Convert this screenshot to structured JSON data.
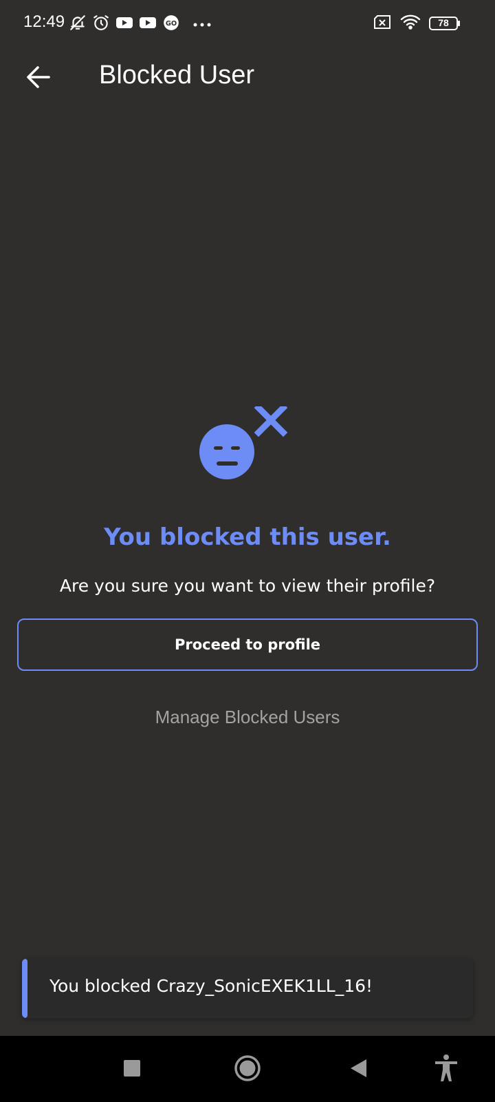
{
  "status_bar": {
    "time": "12:49",
    "battery": "78",
    "icons": [
      "bell-off-icon",
      "alarm-icon",
      "youtube-icon",
      "youtube-icon",
      "go-icon",
      "more-dots-icon",
      "sim-x-icon",
      "wifi-icon",
      "battery-icon"
    ]
  },
  "app_bar": {
    "title": "Blocked User",
    "back_icon": "arrow-left-icon"
  },
  "main": {
    "illustration_icon": "blocked-face-icon",
    "heading": "You blocked this user.",
    "confirm_text": "Are you sure you want to view their profile?",
    "proceed_label": "Proceed to profile",
    "manage_label": "Manage Blocked Users"
  },
  "toast": {
    "message": "You blocked Crazy_SonicEXEK1LL_16!"
  },
  "nav_bar": {
    "icons": [
      "recents-square-icon",
      "home-circle-icon",
      "back-triangle-icon",
      "accessibility-icon"
    ]
  },
  "colors": {
    "background": "#2f2e2c",
    "accent": "#6e8cf5",
    "muted_text": "#a3a3a3",
    "nav_background": "#000000"
  }
}
